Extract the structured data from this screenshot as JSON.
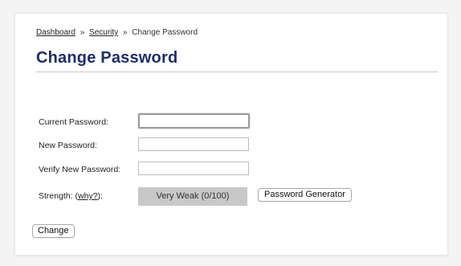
{
  "breadcrumb": {
    "items": [
      "Dashboard",
      "Security",
      "Change Password"
    ],
    "separator": "»"
  },
  "page": {
    "title": "Change Password"
  },
  "form": {
    "current_password_label": "Current Password:",
    "current_password_value": "",
    "new_password_label": "New Password:",
    "new_password_value": "",
    "verify_password_label": "Verify New Password:",
    "verify_password_value": "",
    "strength_label_prefix": "Strength: (",
    "strength_why_link": "why?",
    "strength_label_suffix": "):",
    "strength_value": "Very Weak (0/100)",
    "generator_button": "Password Generator",
    "submit_button": "Change"
  },
  "colors": {
    "title": "#1f2d6b",
    "strength_meter_bg": "#c8c8c8",
    "page_bg": "#f4f4f4",
    "panel_bg": "#ffffff"
  }
}
